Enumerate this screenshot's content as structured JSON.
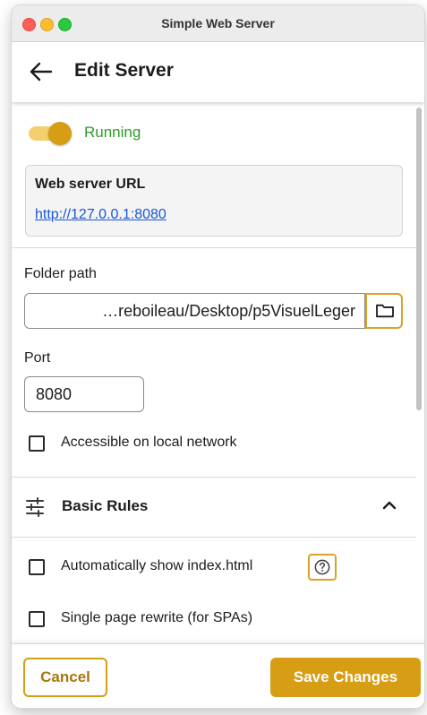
{
  "window": {
    "title": "Simple Web Server"
  },
  "appbar": {
    "title": "Edit Server",
    "back_icon": "arrow-left-icon"
  },
  "server": {
    "running": true,
    "status": "Running",
    "url_label": "Web server URL",
    "url": "http://127.0.0.1:8080"
  },
  "folder": {
    "label": "Folder path",
    "value": "…reboileau/Desktop/p5VisuelLeger",
    "button_icon": "folder-icon"
  },
  "port": {
    "label": "Port",
    "value": "8080"
  },
  "options": {
    "local_network": {
      "label": "Accessible on local network",
      "checked": false
    }
  },
  "basic_rules": {
    "title": "Basic Rules",
    "expanded": true,
    "items": [
      {
        "label": "Automatically show index.html",
        "checked": false,
        "help_icon": "question-circle-icon"
      },
      {
        "label": "Single page rewrite (for SPAs)",
        "checked": false
      }
    ]
  },
  "footer": {
    "cancel_label": "Cancel",
    "save_label": "Save Changes"
  },
  "colors": {
    "accent": "#d69d15",
    "status_green": "#2f9a2c",
    "link": "#1a55d6"
  }
}
